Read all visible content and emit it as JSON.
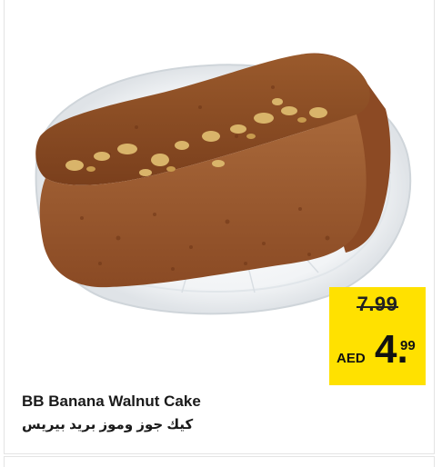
{
  "product": {
    "name_en": "BB Banana Walnut Cake",
    "name_ar": "كيك جوز وموز بريد بيريس",
    "image_icon": "banana-walnut-cake-image"
  },
  "price": {
    "old": "7.99",
    "currency": "AED",
    "new_int": "4.",
    "new_dec": "99",
    "badge_color": "#ffe100"
  }
}
